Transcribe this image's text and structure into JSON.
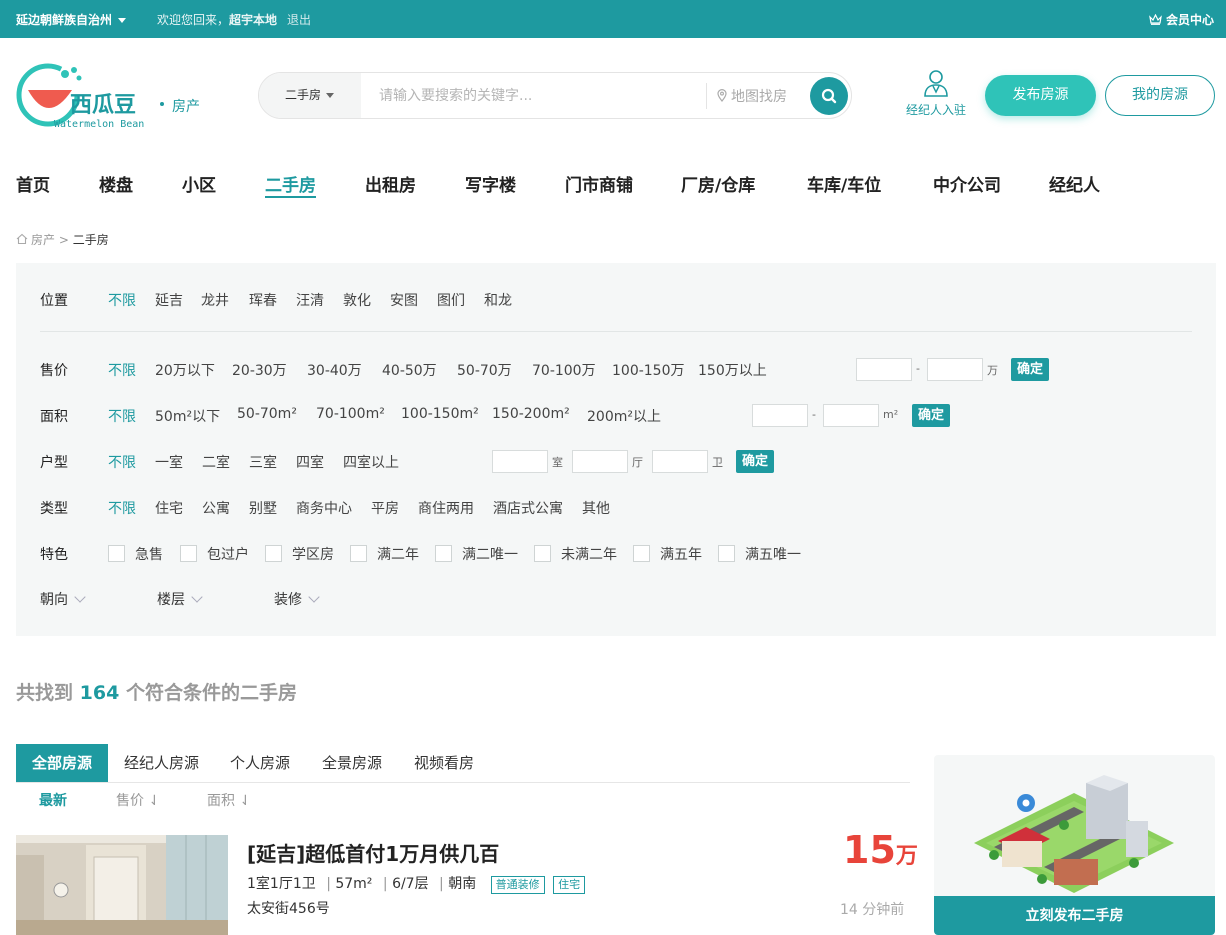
{
  "topbar": {
    "city": "延边朝鲜族自治州",
    "welcome_prefix": "欢迎您回来，",
    "username": "超宇本地",
    "logout": "退出",
    "member_center": "会员中心"
  },
  "logo": {
    "name": "西瓜豆",
    "sub": "房产",
    "english": "Watermelon Bean"
  },
  "search": {
    "type": "二手房",
    "placeholder": "请输入要搜索的关键字...",
    "map_link": "地图找房"
  },
  "header_actions": {
    "agent_join": "经纪人入驻",
    "publish": "发布房源",
    "my_listings": "我的房源"
  },
  "nav": {
    "items": [
      "首页",
      "楼盘",
      "小区",
      "二手房",
      "出租房",
      "写字楼",
      "门市商铺",
      "厂房/仓库",
      "车库/车位",
      "中介公司",
      "经纪人"
    ],
    "active": "二手房"
  },
  "breadcrumb": {
    "root": "房产",
    "sep": ">",
    "current": "二手房"
  },
  "filters": {
    "location": {
      "label": "位置",
      "options": [
        "不限",
        "延吉",
        "龙井",
        "珲春",
        "汪清",
        "敦化",
        "安图",
        "图们",
        "和龙"
      ]
    },
    "price": {
      "label": "售价",
      "options": [
        "不限",
        "20万以下",
        "20-30万",
        "30-40万",
        "40-50万",
        "50-70万",
        "70-100万",
        "100-150万",
        "150万以上"
      ],
      "range_sep": "-",
      "unit": "万",
      "confirm": "确定"
    },
    "area": {
      "label": "面积",
      "options": [
        "不限",
        "50m²以下",
        "50-70m²",
        "70-100m²",
        "100-150m²",
        "150-200m²",
        "200m²以上"
      ],
      "range_sep": "-",
      "unit": "m²",
      "confirm": "确定"
    },
    "layout": {
      "label": "户型",
      "options": [
        "不限",
        "一室",
        "二室",
        "三室",
        "四室",
        "四室以上"
      ],
      "units": [
        "室",
        "厅",
        "卫"
      ],
      "confirm": "确定"
    },
    "type": {
      "label": "类型",
      "options": [
        "不限",
        "住宅",
        "公寓",
        "别墅",
        "商务中心",
        "平房",
        "商住两用",
        "酒店式公寓",
        "其他"
      ]
    },
    "feature": {
      "label": "特色",
      "options": [
        "急售",
        "包过户",
        "学区房",
        "满二年",
        "满二唯一",
        "未满二年",
        "满五年",
        "满五唯一"
      ]
    },
    "dropdowns": [
      "朝向",
      "楼层",
      "装修"
    ]
  },
  "results": {
    "prefix": "共找到",
    "count": "164",
    "suffix": "个符合条件的二手房",
    "tabs": [
      "全部房源",
      "经纪人房源",
      "个人房源",
      "全景房源",
      "视频看房"
    ],
    "active_tab": "全部房源",
    "sort": [
      "最新",
      "售价",
      "面积"
    ],
    "active_sort": "最新",
    "sort_arrow": "⇃"
  },
  "listing": {
    "title": "[延吉]超低首付1万月供几百",
    "layout": "1室1厅1卫",
    "area": "57m²",
    "floor": "6/7层",
    "orientation": "朝南",
    "sep": "|",
    "tags": [
      "普通装修",
      "住宅"
    ],
    "address": "太安街456号",
    "price": "15",
    "price_unit": "万",
    "time": "14 分钟前"
  },
  "sidebar": {
    "cta": "立刻发布二手房"
  },
  "colors": {
    "brand": "#1e9aa0",
    "accent": "#2fc3b8",
    "price": "#e8443a"
  }
}
